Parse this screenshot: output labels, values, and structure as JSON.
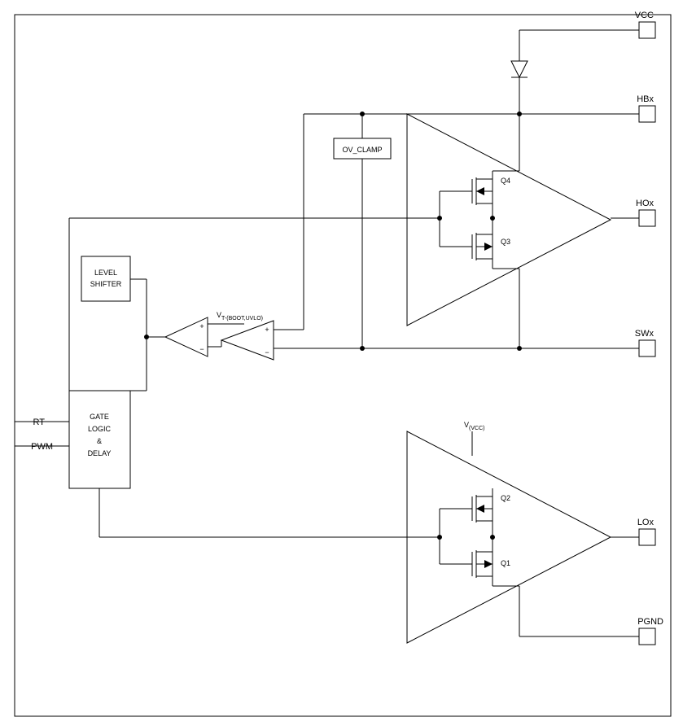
{
  "pins": {
    "vcc": "VCC",
    "hbx": "HBx",
    "hox": "HOx",
    "swx": "SWx",
    "lox": "LOx",
    "pgnd": "PGND",
    "rt": "RT",
    "pwm": "PWM"
  },
  "blocks": {
    "level_shifter": "LEVEL\nSHIFTER",
    "gate_logic": "GATE\nLOGIC\n&\nDELAY",
    "ov_clamp": "OV_CLAMP"
  },
  "components": {
    "q1": "Q1",
    "q2": "Q2",
    "q3": "Q3",
    "q4": "Q4"
  },
  "signals": {
    "vt_boot": "V",
    "vt_boot_sub": "T-(BOOT,UVLO)",
    "vvcc": "V",
    "vvcc_sub": "(VCC)"
  },
  "chart_data": {
    "type": "diagram",
    "description": "Gate driver functional block diagram",
    "pins_right": [
      "VCC",
      "HBx",
      "HOx",
      "SWx",
      "LOx",
      "PGND"
    ],
    "pins_left": [
      "RT",
      "PWM"
    ],
    "internal_blocks": [
      "LEVEL SHIFTER",
      "GATE LOGIC & DELAY",
      "OV_CLAMP"
    ],
    "transistors": [
      "Q1",
      "Q2",
      "Q3",
      "Q4"
    ],
    "amplifiers": 2,
    "comparators": 2,
    "diodes": 1,
    "reference_signals": [
      "V_T-(BOOT,UVLO)",
      "V_(VCC)"
    ]
  }
}
